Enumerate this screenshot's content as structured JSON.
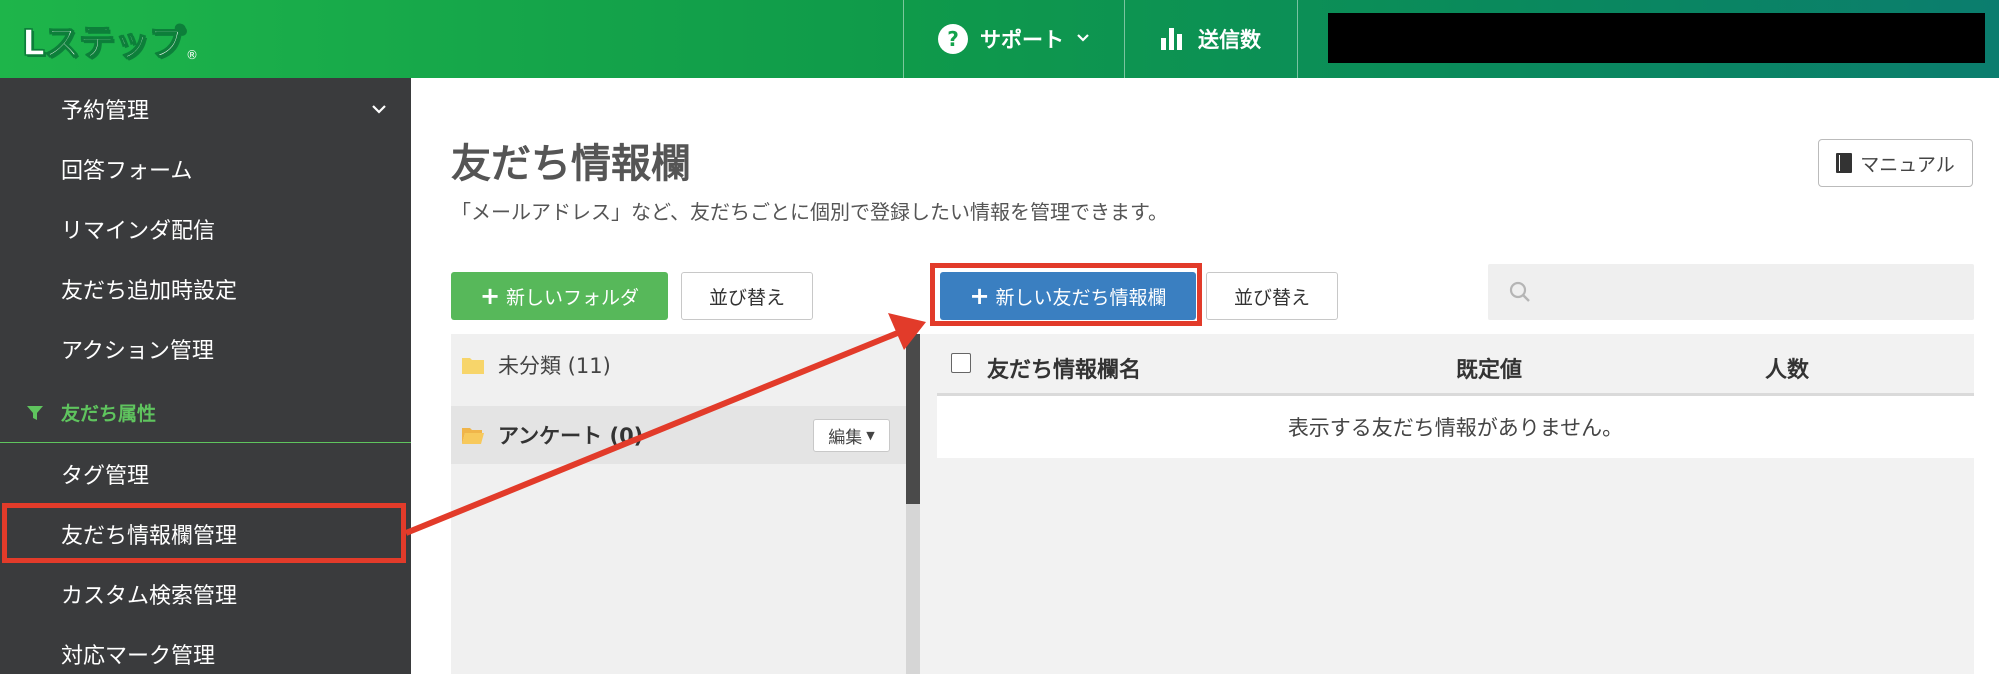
{
  "header": {
    "logo_text": "Lステップ",
    "logo_mark": "®",
    "support_label": "サポート",
    "support_icon": "question-icon",
    "sends_label": "送信数",
    "sends_icon": "bar-chart-icon"
  },
  "sidebar": {
    "items": [
      {
        "label": "予約管理"
      },
      {
        "label": "回答フォーム"
      },
      {
        "label": "リマインダ配信"
      },
      {
        "label": "友だち追加時設定"
      },
      {
        "label": "アクション管理"
      }
    ],
    "section_label": "友だち属性",
    "section_items": [
      {
        "label": "タグ管理"
      },
      {
        "label": "友だち情報欄管理"
      },
      {
        "label": "カスタム検索管理"
      },
      {
        "label": "対応マーク管理"
      }
    ]
  },
  "main": {
    "title": "友だち情報欄",
    "description": "「メールアドレス」など、友だちごとに個別で登録したい情報を管理できます。",
    "manual_label": "マニュアル",
    "new_folder_label": "新しいフォルダ",
    "sort_label_left": "並び替え",
    "new_field_label": "新しい友だち情報欄",
    "sort_label_right": "並び替え",
    "folders": [
      {
        "label": "未分類 (11)"
      },
      {
        "label": "アンケート (0)"
      }
    ],
    "edit_label": "編集",
    "table": {
      "columns": [
        "友だち情報欄名",
        "既定値",
        "人数"
      ],
      "empty_message": "表示する友だち情報がありません。"
    }
  },
  "colors": {
    "header_green": "#1eb54a",
    "sidebar_bg": "#3a3b3d",
    "section_green": "#5fc45e",
    "primary_green": "#57b85a",
    "primary_blue": "#3a7fc1",
    "annotation_red": "#e23b2a"
  }
}
